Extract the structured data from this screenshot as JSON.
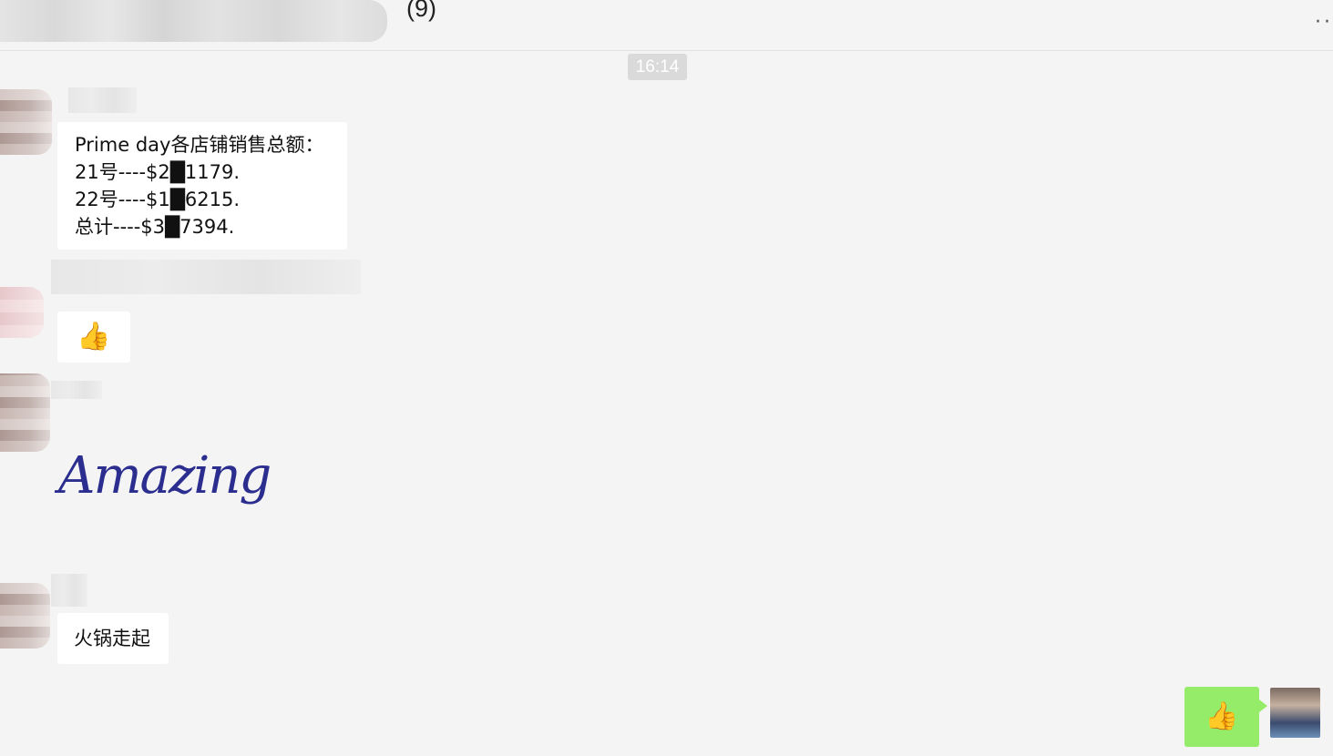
{
  "header": {
    "title_count": "(9)",
    "more_icon": "more-dots-icon"
  },
  "timestamp": "16:14",
  "messages": [
    {
      "lines": [
        "Prime day各店铺销售总额：",
        "21号----$2█1179.",
        "22号----$1█6215.",
        "总计----$3█7394."
      ]
    },
    {
      "sticker": "thumbs-up-icon"
    },
    {
      "sticker_text": "Amazing"
    },
    {
      "text": "火锅走起"
    }
  ],
  "self_message": {
    "sticker": "thumbs-up-icon"
  },
  "colors": {
    "self_bubble": "#95ec69",
    "timestamp_bg": "#dadada",
    "background": "#f4f4f4"
  }
}
